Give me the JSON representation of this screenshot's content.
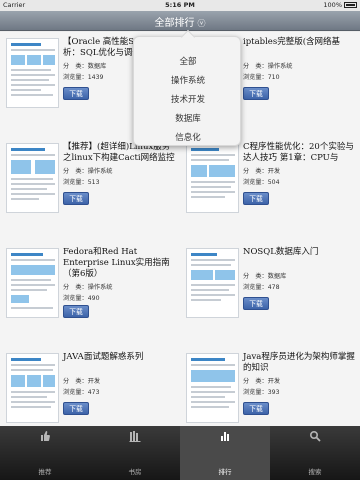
{
  "status_bar": {
    "carrier": "Carrier",
    "time": "5:16 PM",
    "battery": "100%"
  },
  "nav": {
    "title": "全部排行",
    "arrow": "ⓥ"
  },
  "filter_menu": {
    "options": [
      "全部",
      "操作系统",
      "技术开发",
      "数据库",
      "信息化"
    ]
  },
  "download_label": "下载",
  "books": [
    {
      "title": "【Oracle 高性能SQL引擎剖析：SQL优化与调优机制",
      "category": "分　类：数据库",
      "views": "浏览量：1439"
    },
    {
      "title": "iptables完整版(含网络基",
      "category": "分　类：操作系统",
      "views": "浏览量：710"
    },
    {
      "title": "【推荐】(超详细)Linux服务之linux下构建Cacti网络监控",
      "category": "分　类：操作系统",
      "views": "浏览量：513"
    },
    {
      "title": "C程序性能优化：20个实验与达人技巧 第1章：CPU与",
      "category": "分　类：开发",
      "views": "浏览量：504"
    },
    {
      "title": "Fedora和Red Hat Enterprise Linux实用指南（第6版）",
      "category": "分　类：操作系统",
      "views": "浏览量：490"
    },
    {
      "title": "NOSQL数据库入门",
      "category": "分　类：数据库",
      "views": "浏览量：478"
    },
    {
      "title": "JAVA面试题解惑系列",
      "category": "分　类：开发",
      "views": "浏览量：473"
    },
    {
      "title": "Java程序员进化为架构师掌握的知识",
      "category": "分　类：开发",
      "views": "浏览量：393"
    }
  ],
  "tabs": [
    {
      "label": "推荐",
      "icon": "thumbs-up-icon"
    },
    {
      "label": "书房",
      "icon": "bookshelf-icon"
    },
    {
      "label": "排行",
      "icon": "bar-chart-icon",
      "active": true
    },
    {
      "label": "搜索",
      "icon": "search-icon"
    }
  ]
}
